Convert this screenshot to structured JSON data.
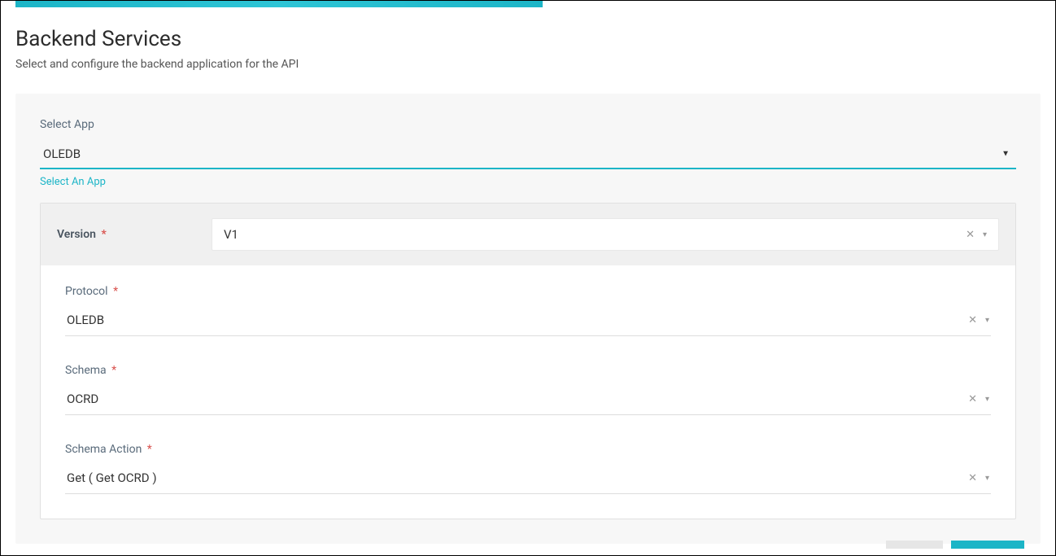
{
  "page": {
    "title": "Backend Services",
    "subtitle": "Select and configure the backend application for the API"
  },
  "app_select": {
    "label": "Select App",
    "value": "OLEDB",
    "helper_link": "Select An App"
  },
  "version": {
    "label": "Version",
    "value": "V1"
  },
  "protocol": {
    "label": "Protocol",
    "value": "OLEDB"
  },
  "schema": {
    "label": "Schema",
    "value": "OCRD"
  },
  "schema_action": {
    "label": "Schema Action",
    "value": "Get ( Get OCRD )"
  },
  "colors": {
    "accent": "#1cb5c7"
  }
}
